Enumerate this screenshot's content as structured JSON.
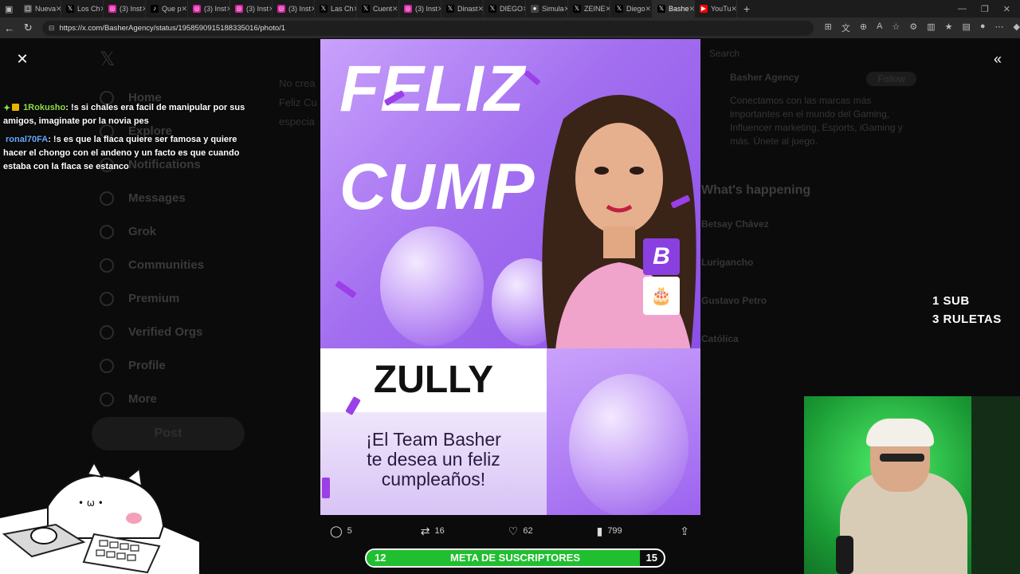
{
  "browser": {
    "tabs": [
      {
        "label": "Nueva",
        "icon": "window-icon",
        "color": "#555555",
        "glyph": "▢"
      },
      {
        "label": "Los Ch",
        "icon": "x-logo-icon",
        "color": "#000000",
        "glyph": "𝕏"
      },
      {
        "label": "(3) Inst",
        "icon": "instagram-icon",
        "color": "#d6249f",
        "glyph": "◎"
      },
      {
        "label": "Que p",
        "icon": "tiktok-icon",
        "color": "#000000",
        "glyph": "♪"
      },
      {
        "label": "(3) Inst",
        "icon": "instagram-icon",
        "color": "#d6249f",
        "glyph": "◎"
      },
      {
        "label": "(3) Inst",
        "icon": "instagram-icon",
        "color": "#d6249f",
        "glyph": "◎"
      },
      {
        "label": "(3) Inst",
        "icon": "instagram-icon",
        "color": "#d6249f",
        "glyph": "◎"
      },
      {
        "label": "Las Ch",
        "icon": "x-logo-icon",
        "color": "#000000",
        "glyph": "𝕏"
      },
      {
        "label": "Cuent",
        "icon": "x-logo-icon",
        "color": "#000000",
        "glyph": "𝕏"
      },
      {
        "label": "(3) Inst",
        "icon": "instagram-icon",
        "color": "#d6249f",
        "glyph": "◎"
      },
      {
        "label": "Dinast",
        "icon": "x-logo-icon",
        "color": "#000000",
        "glyph": "𝕏"
      },
      {
        "label": "DIEGO",
        "icon": "x-logo-icon",
        "color": "#000000",
        "glyph": "𝕏"
      },
      {
        "label": "Simula",
        "icon": "web-icon",
        "color": "#444444",
        "glyph": "●"
      },
      {
        "label": "ZEINE",
        "icon": "x-logo-icon",
        "color": "#000000",
        "glyph": "𝕏"
      },
      {
        "label": "Diego",
        "icon": "x-logo-icon",
        "color": "#000000",
        "glyph": "𝕏"
      },
      {
        "label": "Bashe",
        "icon": "x-logo-icon",
        "color": "#000000",
        "glyph": "𝕏",
        "active": true
      },
      {
        "label": "YouTu",
        "icon": "youtube-icon",
        "color": "#ff0000",
        "glyph": "▶"
      }
    ],
    "url": "https://x.com/BasherAgency/status/1958590915188335016/photo/1"
  },
  "background_page": {
    "nav": [
      "Home",
      "Explore",
      "Notifications",
      "Messages",
      "Grok",
      "Communities",
      "Premium",
      "Verified Orgs",
      "Profile",
      "More"
    ],
    "post_button": "Post",
    "middle_lines": [
      "No crea",
      "",
      "Feliz Cu",
      "especia"
    ],
    "sidebar": {
      "search": "Search",
      "account": "Basher Agency",
      "follow": "Follow",
      "bio": "Conectamos con las marcas más importantes en el mundo del Gaming, Influencer marketing, Esports, iGaming y más. Únete al juego.",
      "whats_happening": "What's happening",
      "trends": [
        "Betsay Chávez",
        "Lurigancho",
        "Gustavo Petro",
        "Católica"
      ]
    }
  },
  "photo": {
    "headline_1": "FELIZ",
    "headline_2": "CUMP",
    "name": "ZULLY",
    "message_1": "¡El Team Basher",
    "message_2": "te desea un feliz",
    "message_3": "cumpleaños!",
    "brand_mark": "B"
  },
  "tweet_actions": {
    "replies": "5",
    "reposts": "16",
    "likes": "62",
    "views": "799"
  },
  "chat": [
    {
      "user": "1Rokusho",
      "text": ": !s si chales era facil de manipular por sus amigos, imaginate por la novia pes"
    },
    {
      "user": "ronal70FA",
      "text": ": !s es que la flaca quiere ser famosa y quiere hacer el chongo con el andeno y un facto es que cuando estaba con la flaca se estanco"
    }
  ],
  "overlay": {
    "sub_line_1": "1 SUB",
    "sub_line_2": "3 RULETAS"
  },
  "meta": {
    "start": "12",
    "label": "META DE SUSCRIPTORES",
    "end": "15",
    "progress_fraction": 0.92
  },
  "colors": {
    "accent_purple": "#9b3fe8",
    "progress_green": "#1fbf2f",
    "chat_user1": "#8fe04a",
    "chat_user2": "#6aa8ff"
  }
}
